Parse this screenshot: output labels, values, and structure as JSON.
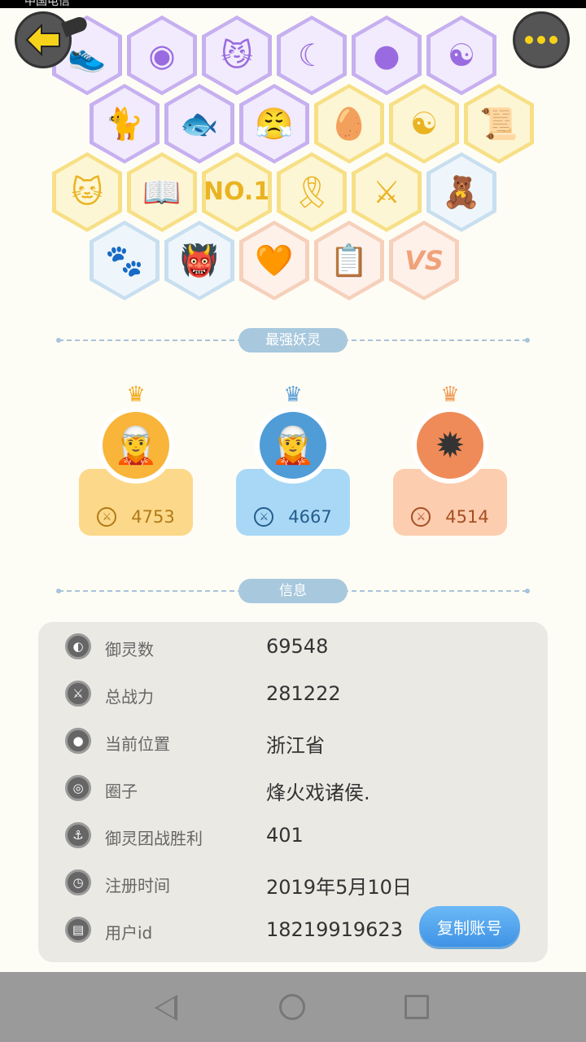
{
  "status_bar": {
    "carrier": "中国电信"
  },
  "header": {
    "back_icon": "arrow-left-icon",
    "more_icon": "more-dots-icon"
  },
  "badges": [
    {
      "id": "b1",
      "color": "purple",
      "glyph": "👟"
    },
    {
      "id": "b2",
      "color": "purple",
      "glyph": "◉"
    },
    {
      "id": "b3",
      "color": "purple",
      "glyph": "😼"
    },
    {
      "id": "b4",
      "color": "purple",
      "glyph": "☾"
    },
    {
      "id": "b5",
      "color": "purple",
      "glyph": "●"
    },
    {
      "id": "b6",
      "color": "purple",
      "glyph": "☯"
    },
    {
      "id": "b7",
      "color": "purple",
      "glyph": "🐈"
    },
    {
      "id": "b8",
      "color": "purple",
      "glyph": "🐟"
    },
    {
      "id": "b9",
      "color": "purple",
      "glyph": "😤"
    },
    {
      "id": "b10",
      "color": "gold",
      "glyph": "🥚"
    },
    {
      "id": "b11",
      "color": "gold",
      "glyph": "☯"
    },
    {
      "id": "b12",
      "color": "gold",
      "glyph": "📜"
    },
    {
      "id": "b13",
      "color": "gold",
      "glyph": "🐱"
    },
    {
      "id": "b14",
      "color": "gold",
      "glyph": "📖"
    },
    {
      "id": "b15",
      "color": "gold",
      "glyph": "NO.1"
    },
    {
      "id": "b16",
      "color": "gold",
      "glyph": "🎗"
    },
    {
      "id": "b17",
      "color": "gold",
      "glyph": "⚔"
    },
    {
      "id": "b18",
      "color": "blue",
      "glyph": "🧸"
    },
    {
      "id": "b19",
      "color": "blue",
      "glyph": "🐾"
    },
    {
      "id": "b20",
      "color": "blue",
      "glyph": "👹"
    },
    {
      "id": "b21",
      "color": "peach",
      "glyph": "🧡"
    },
    {
      "id": "b22",
      "color": "peach",
      "glyph": "📋"
    },
    {
      "id": "b23",
      "color": "peach",
      "glyph": "VS"
    }
  ],
  "strongest": {
    "title": "最强妖灵",
    "champions": [
      {
        "rank": 1,
        "avatar_icon": "champion-avatar-icon",
        "crown_icon": "gold-crown-icon",
        "power": "4753"
      },
      {
        "rank": 2,
        "avatar_icon": "champion-avatar-icon",
        "crown_icon": "silver-crown-icon",
        "power": "4667"
      },
      {
        "rank": 3,
        "avatar_icon": "champion-avatar-icon",
        "crown_icon": "bronze-crown-icon",
        "power": "4514"
      }
    ]
  },
  "info": {
    "title": "信息",
    "rows": [
      {
        "label": "御灵数",
        "value": "69548",
        "icon": "spirit-count-icon"
      },
      {
        "label": "总战力",
        "value": "281222",
        "icon": "sword-icon"
      },
      {
        "label": "当前位置",
        "value": "浙江省",
        "icon": "location-pin-icon"
      },
      {
        "label": "圈子",
        "value": "烽火戏诸侯.",
        "icon": "circle-icon"
      },
      {
        "label": "御灵团战胜利",
        "value": "401",
        "icon": "anchor-icon"
      },
      {
        "label": "注册时间",
        "value": "2019年5月10日",
        "icon": "clock-icon"
      },
      {
        "label": "用户id",
        "value": "18219919623",
        "icon": "id-card-icon"
      }
    ],
    "copy_button": "复制账号"
  },
  "colors": {
    "background": "#fefdf5",
    "accent_blue": "#3f93e6",
    "card_bg": "#ebe9e4"
  }
}
